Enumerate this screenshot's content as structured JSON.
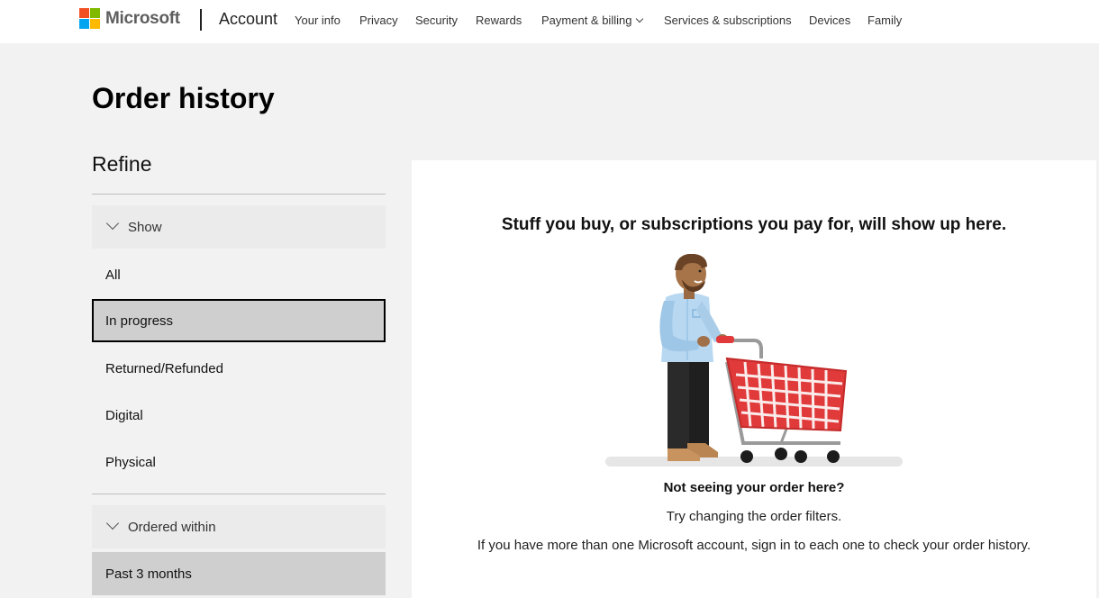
{
  "brand": {
    "name": "Microsoft",
    "logo_colors": [
      "#f25022",
      "#7fba00",
      "#00a4ef",
      "#ffb900"
    ]
  },
  "header": {
    "section": "Account",
    "nav": [
      {
        "label": "Your info"
      },
      {
        "label": "Privacy"
      },
      {
        "label": "Security"
      },
      {
        "label": "Rewards"
      },
      {
        "label": "Payment & billing",
        "has_dropdown": true
      },
      {
        "label": "Services & subscriptions"
      },
      {
        "label": "Devices"
      },
      {
        "label": "Family"
      }
    ]
  },
  "page": {
    "title": "Order history"
  },
  "refine": {
    "title": "Refine",
    "show": {
      "label": "Show",
      "options": [
        "All",
        "In progress",
        "Returned/Refunded",
        "Digital",
        "Physical"
      ],
      "selected": "In progress"
    },
    "ordered_within": {
      "label": "Ordered within",
      "options": [
        "Past 3 months"
      ],
      "selected": "Past 3 months"
    }
  },
  "empty_state": {
    "heading": "Stuff you buy, or subscriptions you pay for, will show up here.",
    "illustration": "person-with-shopping-cart",
    "not_seeing": "Not seeing your order here?",
    "try_changing": "Try changing the order filters.",
    "multiple_accounts": "If you have more than one Microsoft account, sign in to each one to check your order history."
  },
  "colors": {
    "cart": "#e03a3a",
    "page_bg": "#f2f2f2",
    "selected_bg": "#cfcfcf"
  }
}
